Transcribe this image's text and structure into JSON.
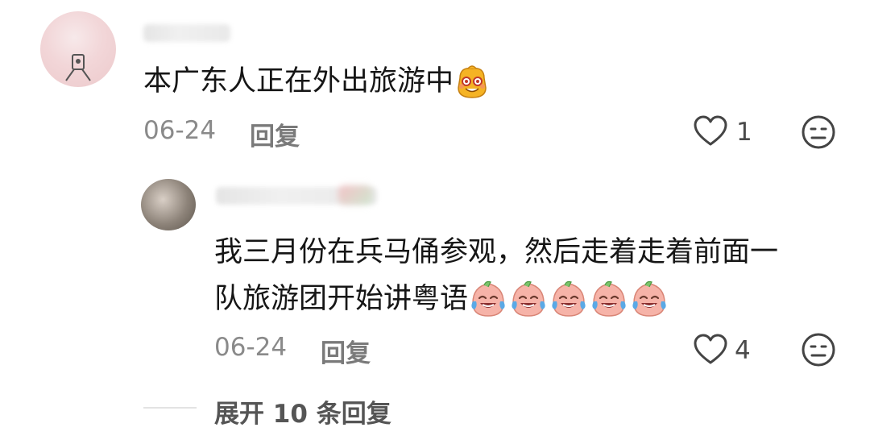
{
  "comment": {
    "text": "本广东人正在外出旅游中",
    "emoji": "nervous-smile-emoji",
    "date": "06-24",
    "reply_label": "回复",
    "like_count": "1"
  },
  "reply": {
    "text_line1": "我三月份在兵马俑参观，然后走着走着前面一",
    "text_line2": "队旅游团开始讲粤语",
    "emoji": "crying-laughing-peach-emoji",
    "emoji_count": 5,
    "date": "06-24",
    "reply_label": "回复",
    "like_count": "4"
  },
  "expand_label": "展开 10 条回复",
  "colors": {
    "text": "#161616",
    "meta": "#8a8a8a",
    "accent": "#f0a11a"
  }
}
